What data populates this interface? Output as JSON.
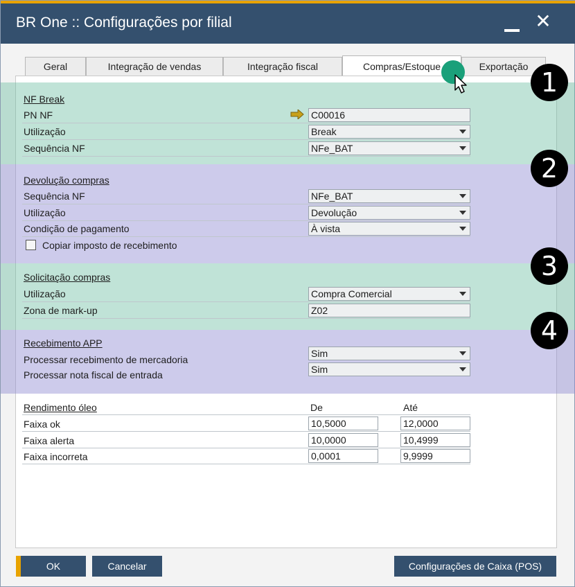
{
  "window": {
    "title": "BR One :: Configurações por filial"
  },
  "tabs": [
    "Geral",
    "Integração de vendas",
    "Integração fiscal",
    "Compras/Estoque",
    "Exportação"
  ],
  "active_tab": "Compras/Estoque",
  "colors": {
    "titlebar": "#34506e",
    "accent": "#e8a300",
    "band_green": "#68bca0",
    "band_purple": "#908cd2"
  },
  "badges": [
    "1",
    "2",
    "3",
    "4"
  ],
  "nf_break": {
    "header": "NF Break",
    "pn_nf": {
      "label": "PN NF",
      "value": "C00016"
    },
    "utilizacao": {
      "label": "Utilização",
      "value": "Break"
    },
    "sequencia": {
      "label": "Sequência NF",
      "value": "NFe_BAT"
    }
  },
  "devolucao": {
    "header": "Devolução compras",
    "sequencia": {
      "label": "Sequência NF",
      "value": "NFe_BAT"
    },
    "utilizacao": {
      "label": "Utilização",
      "value": "Devolução"
    },
    "condicao": {
      "label": "Condição de pagamento",
      "value": "À vista"
    },
    "copiar": {
      "label": "Copiar imposto de recebimento",
      "checked": false
    }
  },
  "solicitacao": {
    "header": "Solicitação compras",
    "utilizacao": {
      "label": "Utilização",
      "value": "Compra Comercial"
    },
    "zona": {
      "label": "Zona de mark-up",
      "value": "Z02"
    }
  },
  "recebimento": {
    "header": "Recebimento APP",
    "processar_merc": {
      "label": "Processar recebimento de mercadoria",
      "value": "Sim"
    },
    "processar_nf": {
      "label": "Processar nota fiscal de entrada",
      "value": "Sim"
    }
  },
  "rendimento": {
    "header": "Rendimento óleo",
    "col_de": "De",
    "col_ate": "Até",
    "rows": [
      {
        "label": "Faixa ok",
        "de": "10,5000",
        "ate": "12,0000"
      },
      {
        "label": "Faixa alerta",
        "de": "10,0000",
        "ate": "10,4999"
      },
      {
        "label": "Faixa incorreta",
        "de": "0,0001",
        "ate": "9,9999"
      }
    ]
  },
  "buttons": {
    "ok": "OK",
    "cancel": "Cancelar",
    "pos": "Configurações de Caixa (POS)"
  }
}
